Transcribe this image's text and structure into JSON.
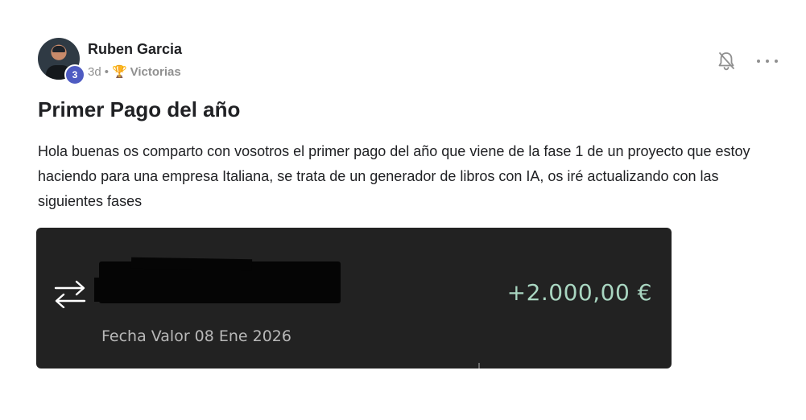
{
  "post": {
    "author": {
      "name": "Ruben Garcia",
      "level": "3",
      "avatar_icon": "user-avatar",
      "level_badge_color": "#4e5bc2"
    },
    "meta": {
      "time_ago": "3d",
      "separator": "•",
      "category_icon": "trophy-icon",
      "category": "Victorias"
    },
    "actions": {
      "notify_icon": "bell-off-icon",
      "more_icon": "more-horizontal-icon"
    },
    "title": "Primer Pago del año",
    "body": "Hola buenas os comparto con vosotros el primer pago del año que viene de la fase 1 de un proyecto que estoy haciendo para una empresa Italiana, se trata de un generador de libros con IA, os iré actualizando con las siguientes fases",
    "attachment": {
      "type": "bank-transaction-screenshot",
      "transfer_icon": "transfer-arrows-icon",
      "amount": "+2.000,00 €",
      "amount_color": "#a9d6c1",
      "value_date_label": "Fecha Valor",
      "value_date": "08 Ene 2026",
      "background_color": "#222222"
    }
  }
}
